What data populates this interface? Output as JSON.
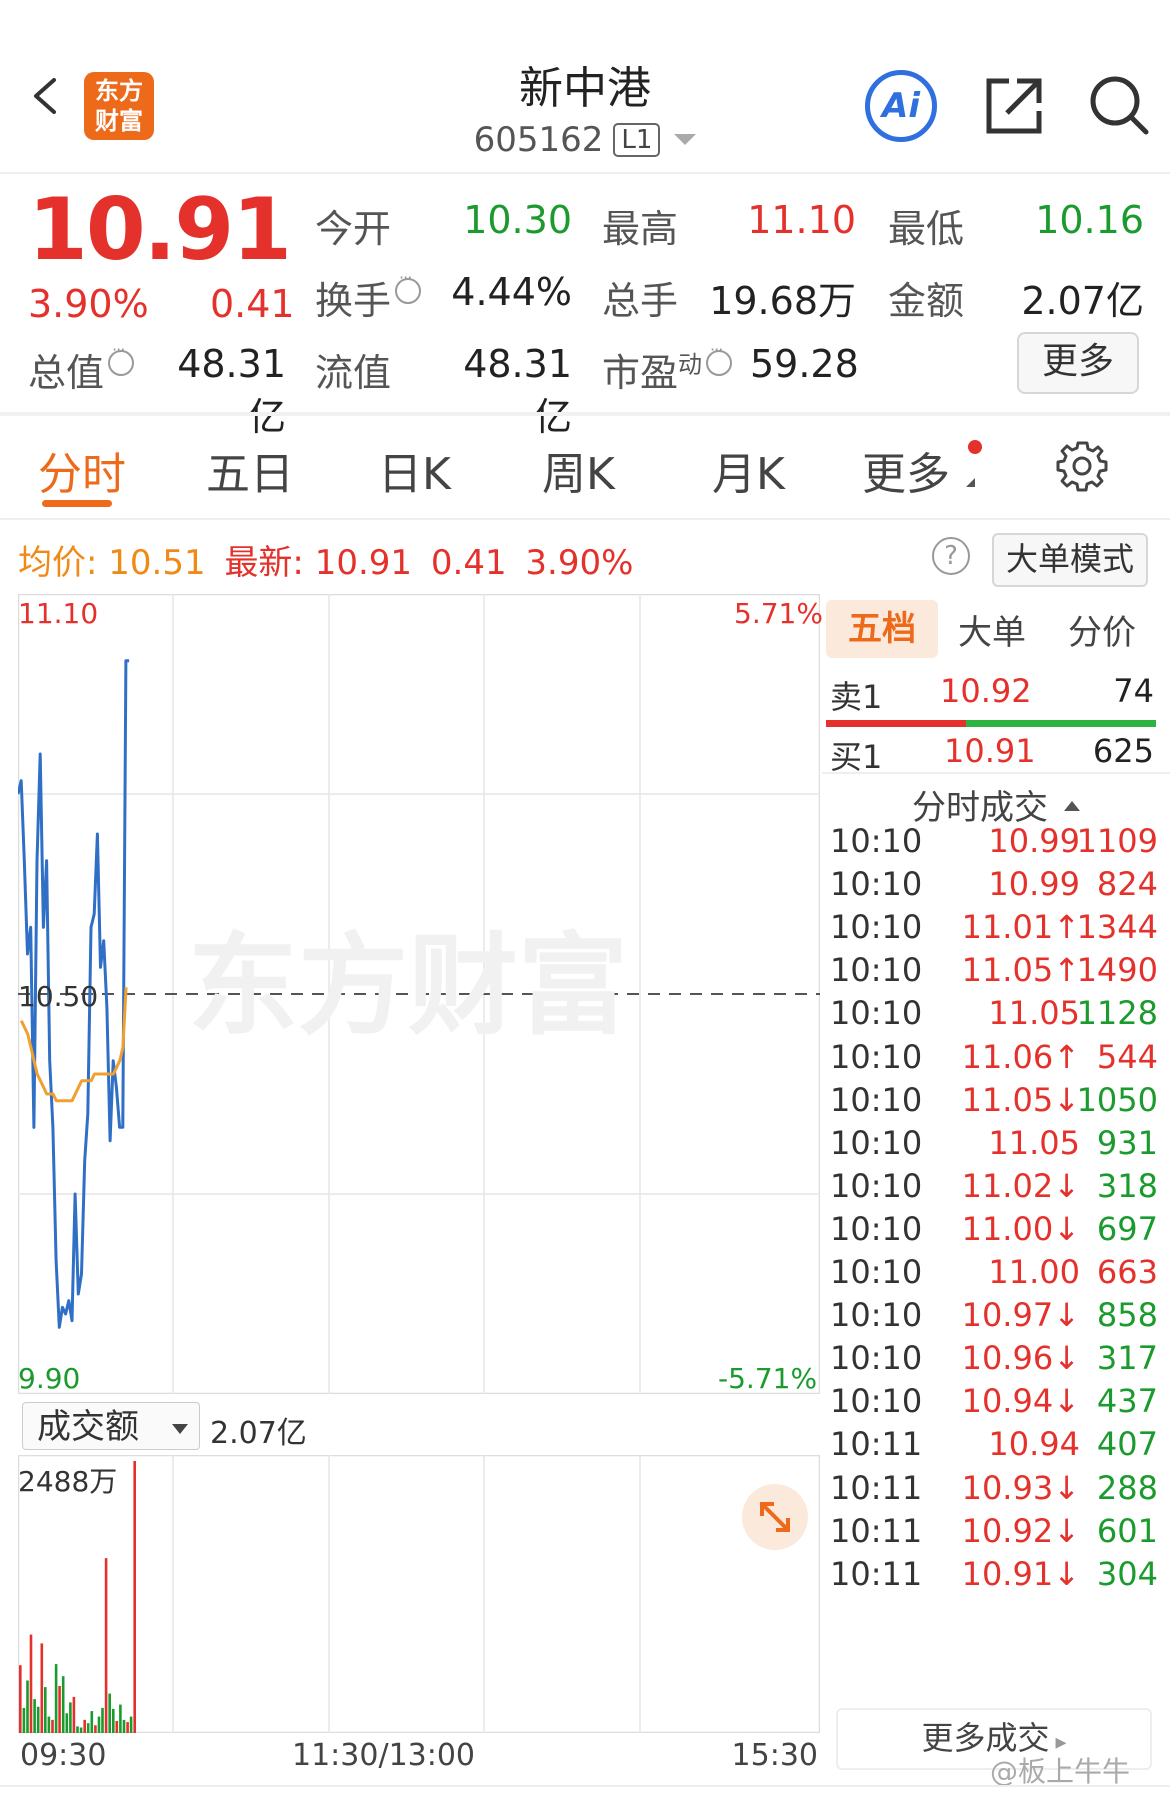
{
  "header": {
    "logo_line1": "东方",
    "logo_line2": "财富",
    "title": "新中港",
    "code": "605162",
    "level": "L1",
    "ai_label": "Ai"
  },
  "quote": {
    "price": "10.91",
    "change_pct": "3.90%",
    "change": "0.41",
    "open_label": "今开",
    "open": "10.30",
    "high_label": "最高",
    "high": "11.10",
    "low_label": "最低",
    "low": "10.16",
    "turnover_label": "换手",
    "turnover": "4.44%",
    "volume_label": "总手",
    "volume": "19.68万",
    "amount_label": "金额",
    "amount": "2.07亿",
    "mktcap_label": "总值",
    "mktcap": "48.31亿",
    "float_label": "流值",
    "float": "48.31亿",
    "pe_label": "市盈",
    "pe_sup": "动",
    "pe": "59.28",
    "more_button": "更多"
  },
  "tabs": [
    {
      "label": "分时"
    },
    {
      "label": "五日"
    },
    {
      "label": "日K"
    },
    {
      "label": "周K"
    },
    {
      "label": "月K"
    },
    {
      "label": "更多"
    }
  ],
  "info_line": {
    "avg_label": "均价:",
    "avg": "10.51",
    "latest_label": "最新:",
    "latest": "10.91",
    "change": "0.41",
    "change_pct": "3.90%",
    "help": "?",
    "mode_button": "大单模式"
  },
  "right_panel": {
    "tabs": [
      "五档",
      "大单",
      "分价"
    ],
    "sell1_label": "卖1",
    "sell1_price": "10.92",
    "sell1_vol": "74",
    "buy1_label": "买1",
    "buy1_price": "10.91",
    "buy1_vol": "625",
    "ts_title": "分时成交",
    "trades": [
      {
        "time": "10:10",
        "price": "10.99",
        "vol": "1109",
        "vcolor": "red"
      },
      {
        "time": "10:10",
        "price": "10.99",
        "vol": "824",
        "vcolor": "red"
      },
      {
        "time": "10:10",
        "price": "11.01↑",
        "vol": "1344",
        "vcolor": "red"
      },
      {
        "time": "10:10",
        "price": "11.05↑",
        "vol": "1490",
        "vcolor": "red"
      },
      {
        "time": "10:10",
        "price": "11.05",
        "vol": "1128",
        "vcolor": "green"
      },
      {
        "time": "10:10",
        "price": "11.06↑",
        "vol": "544",
        "vcolor": "red"
      },
      {
        "time": "10:10",
        "price": "11.05↓",
        "vol": "1050",
        "vcolor": "green"
      },
      {
        "time": "10:10",
        "price": "11.05",
        "vol": "931",
        "vcolor": "green"
      },
      {
        "time": "10:10",
        "price": "11.02↓",
        "vol": "318",
        "vcolor": "green"
      },
      {
        "time": "10:10",
        "price": "11.00↓",
        "vol": "697",
        "vcolor": "green"
      },
      {
        "time": "10:10",
        "price": "11.00",
        "vol": "663",
        "vcolor": "red"
      },
      {
        "time": "10:10",
        "price": "10.97↓",
        "vol": "858",
        "vcolor": "green"
      },
      {
        "time": "10:10",
        "price": "10.96↓",
        "vol": "317",
        "vcolor": "green"
      },
      {
        "time": "10:10",
        "price": "10.94↓",
        "vol": "437",
        "vcolor": "green"
      },
      {
        "time": "10:11",
        "price": "10.94",
        "vol": "407",
        "vcolor": "green"
      },
      {
        "time": "10:11",
        "price": "10.93↓",
        "vol": "288",
        "vcolor": "green"
      },
      {
        "time": "10:11",
        "price": "10.92↓",
        "vol": "601",
        "vcolor": "green"
      },
      {
        "time": "10:11",
        "price": "10.91↓",
        "vol": "304",
        "vcolor": "green"
      }
    ],
    "more_deals": "更多成交"
  },
  "chart": {
    "y_top": "11.10",
    "y_mid": "10.50",
    "y_bottom": "9.90",
    "pct_top": "5.71%",
    "pct_bottom": "-5.71%",
    "vol_selector": "成交额",
    "vol_total": "2.07亿",
    "vol_max": "2488万",
    "x_labels": [
      "09:30",
      "11:30/13:00",
      "15:30"
    ],
    "watermark": "东方财富",
    "colors": {
      "price_line": "#2f6fc6",
      "avg_line": "#f0a030",
      "up": "#e4312b",
      "down": "#1b9a2d"
    }
  },
  "chart_data": {
    "type": "line",
    "title": "",
    "ylim": [
      9.9,
      11.1
    ],
    "prev_close": 10.5,
    "series": [
      {
        "name": "",
        "values": [
          10.8,
          10.82,
          10.7,
          10.56,
          10.6,
          10.3,
          10.7,
          10.86,
          10.6,
          10.7,
          10.4,
          10.3,
          10.1,
          10.0,
          10.03,
          10.02,
          10.04,
          10.01,
          10.2,
          10.05,
          10.08,
          10.25,
          10.32,
          10.6,
          10.62,
          10.74,
          10.54,
          10.58,
          10.48,
          10.28,
          10.4,
          10.36,
          10.3,
          10.3,
          11.0,
          11.0
        ]
      },
      {
        "name": "",
        "values": [
          10.46,
          10.45,
          10.44,
          10.42,
          10.4,
          10.38,
          10.37,
          10.36,
          10.35,
          10.35,
          10.35,
          10.34,
          10.34,
          10.34,
          10.34,
          10.34,
          10.34,
          10.35,
          10.36,
          10.37,
          10.37,
          10.37,
          10.37,
          10.38,
          10.38,
          10.38,
          10.38,
          10.38,
          10.38,
          10.38,
          10.39,
          10.4,
          10.42,
          10.51
        ]
      }
    ],
    "volume": [
      620,
      230,
      480,
      900,
      310,
      240,
      820,
      420,
      150,
      120,
      630,
      430,
      520,
      180,
      280,
      330,
      60,
      50,
      120,
      90,
      200,
      70,
      150,
      230,
      1600,
      360,
      220,
      110,
      260,
      120,
      100,
      150,
      2488
    ]
  }
}
